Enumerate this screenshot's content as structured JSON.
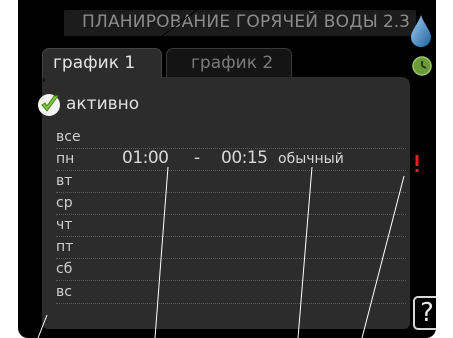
{
  "header": {
    "title": "ПЛАНИРОВАНИЕ ГОРЯЧЕЙ ВОДЫ",
    "menu_number": "2.3"
  },
  "tabs": [
    {
      "label": "график 1",
      "active": true
    },
    {
      "label": "график 2",
      "active": false
    }
  ],
  "active": {
    "label": "активно",
    "checked": true
  },
  "days": [
    {
      "label": "все"
    },
    {
      "label": "пн",
      "start": "01:00",
      "dash": "-",
      "end": "00:15",
      "mode": "обычный"
    },
    {
      "label": "вт"
    },
    {
      "label": "ср"
    },
    {
      "label": "чт"
    },
    {
      "label": "пт"
    },
    {
      "label": "сб"
    },
    {
      "label": "вс"
    }
  ],
  "icons": {
    "hot_water": "water-drop-icon",
    "timer": "clock-icon",
    "conflict": "exclamation-icon",
    "help": "help-icon",
    "check": "checkmark-icon"
  },
  "help_symbol": "?",
  "colors": {
    "screen_bg": "#000000",
    "panel_bg": "#2c2c2c",
    "drop_blue": "#3a86c8",
    "clock_green": "#6a9a3a",
    "check_green": "#7cc242",
    "warning_red": "#e0201c"
  }
}
